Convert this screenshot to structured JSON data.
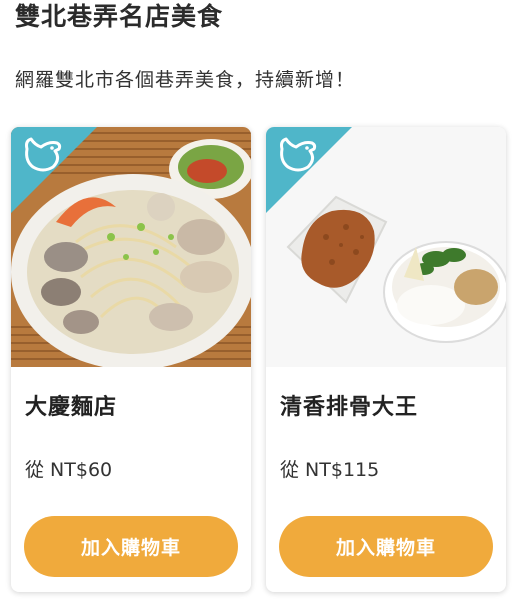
{
  "header": {
    "title": "雙北巷弄名店美食",
    "subtitle": "網羅雙北市各個巷弄美食，持續新增！"
  },
  "colors": {
    "accent_button": "#f0aa3c",
    "ribbon": "#4fb6c9"
  },
  "products": [
    {
      "name": "大慶麵店",
      "price": "從 NT$60",
      "button_label": "加入購物車",
      "badge_icon": "bird-icon",
      "image": "seafood-noodle-soup"
    },
    {
      "name": "清香排骨大王",
      "price": "從 NT$115",
      "button_label": "加入購物車",
      "badge_icon": "bird-icon",
      "image": "pork-chop-rice"
    }
  ]
}
